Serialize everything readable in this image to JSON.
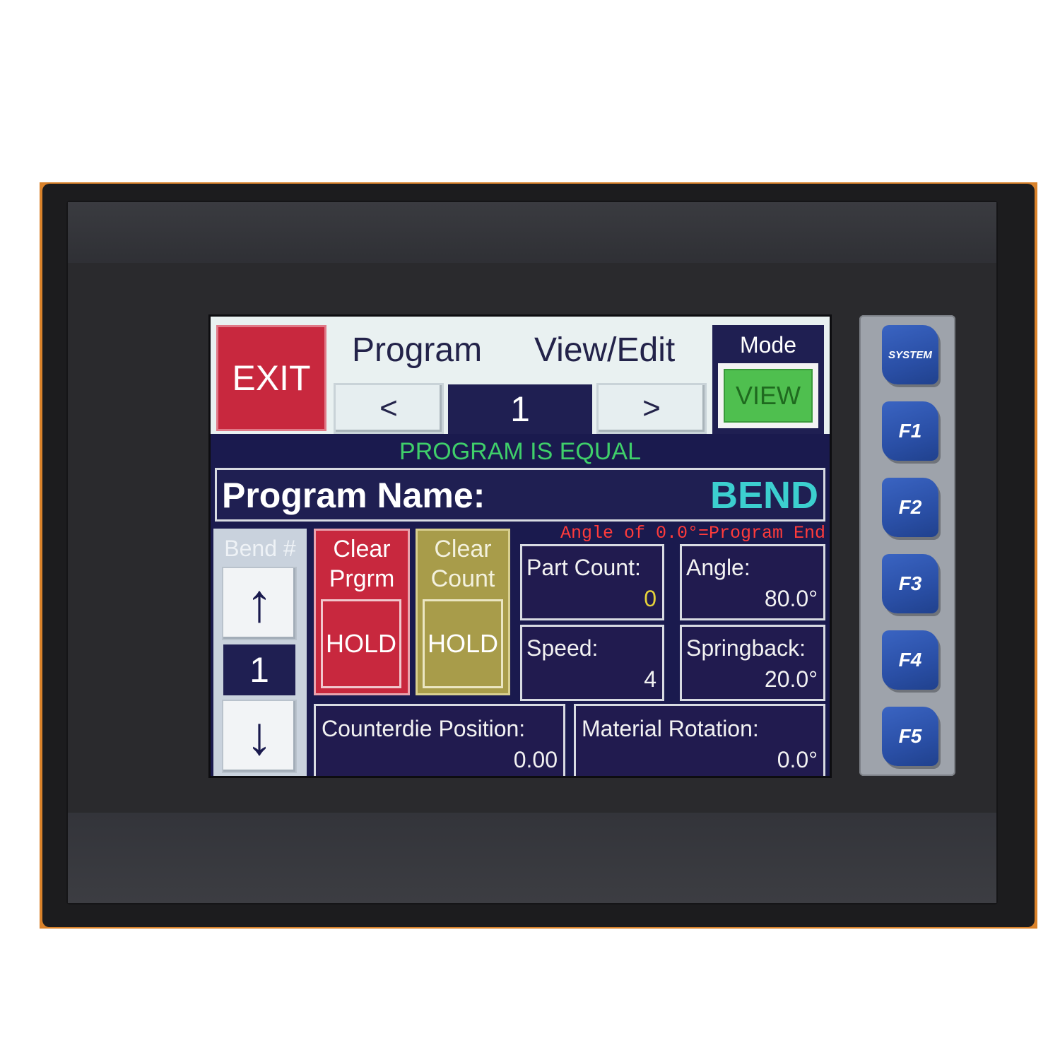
{
  "header": {
    "exit_label": "EXIT",
    "title_left": "Program",
    "title_right": "View/Edit",
    "prev_label": "<",
    "program_number": "1",
    "next_label": ">",
    "mode_label": "Mode",
    "mode_value": "VIEW"
  },
  "status": {
    "message": "PROGRAM IS EQUAL",
    "warning": "Angle of 0.0°=Program End"
  },
  "program": {
    "name_label": "Program Name:",
    "name_value": "BEND"
  },
  "bend": {
    "label": "Bend #",
    "up_arrow": "↑",
    "number": "1",
    "down_arrow": "↓"
  },
  "buttons": {
    "clear_program_line1": "Clear",
    "clear_program_line2": "Prgrm",
    "clear_program_hold": "HOLD",
    "clear_count_line1": "Clear",
    "clear_count_line2": "Count",
    "clear_count_hold": "HOLD"
  },
  "fields": {
    "part_count_label": "Part Count:",
    "part_count_value": "0",
    "angle_label": "Angle:",
    "angle_value": "80.0°",
    "speed_label": "Speed:",
    "speed_value": "4",
    "springback_label": "Springback:",
    "springback_value": "20.0°",
    "counterdie_label": "Counterdie Position:",
    "counterdie_value": "0.00",
    "rotation_label": "Material Rotation:",
    "rotation_value": "0.0°"
  },
  "keys": {
    "system": "SYSTEM",
    "f1": "F1",
    "f2": "F2",
    "f3": "F3",
    "f4": "F4",
    "f5": "F5"
  },
  "colors": {
    "screen_bg": "#1a1a4e",
    "exit_red": "#c8283e",
    "clear_program_red": "#c8283e",
    "clear_count_olive": "#a89c4a",
    "mode_green": "#4fbf4f",
    "status_green": "#3fcf6a",
    "warning_red": "#ff3b3b",
    "name_cyan": "#3ccfcf",
    "part_count_yellow": "#e6d23a",
    "key_blue": "#2f58b4"
  }
}
